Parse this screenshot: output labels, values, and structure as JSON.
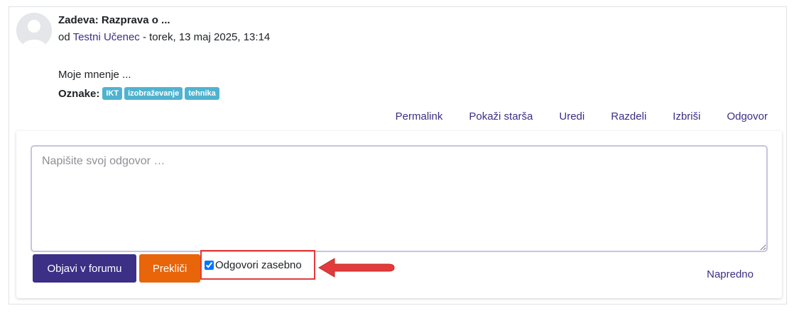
{
  "post": {
    "subject": "Zadeva: Razprava o ...",
    "by_prefix": "od ",
    "author": "Testni Učenec",
    "date": " - torek, 13 maj 2025, 13:14",
    "message": "Moje mnenje ...",
    "tags_label": "Oznake:",
    "tags": [
      "IKT",
      "izobraževanje",
      "tehnika"
    ],
    "actions": [
      "Permalink",
      "Pokaži starša",
      "Uredi",
      "Razdeli",
      "Izbriši",
      "Odgovor"
    ]
  },
  "reply": {
    "placeholder": "Napišite svoj odgovor …",
    "submit_label": "Objavi v forumu",
    "cancel_label": "Prekliči",
    "private_label": "Odgovori zasebno",
    "private_checked": true,
    "advanced_label": "Napredno"
  },
  "colors": {
    "brand": "#3b2f86",
    "cancel": "#e8650a",
    "badge": "#4fb3cf",
    "highlight": "#e23b3b"
  }
}
